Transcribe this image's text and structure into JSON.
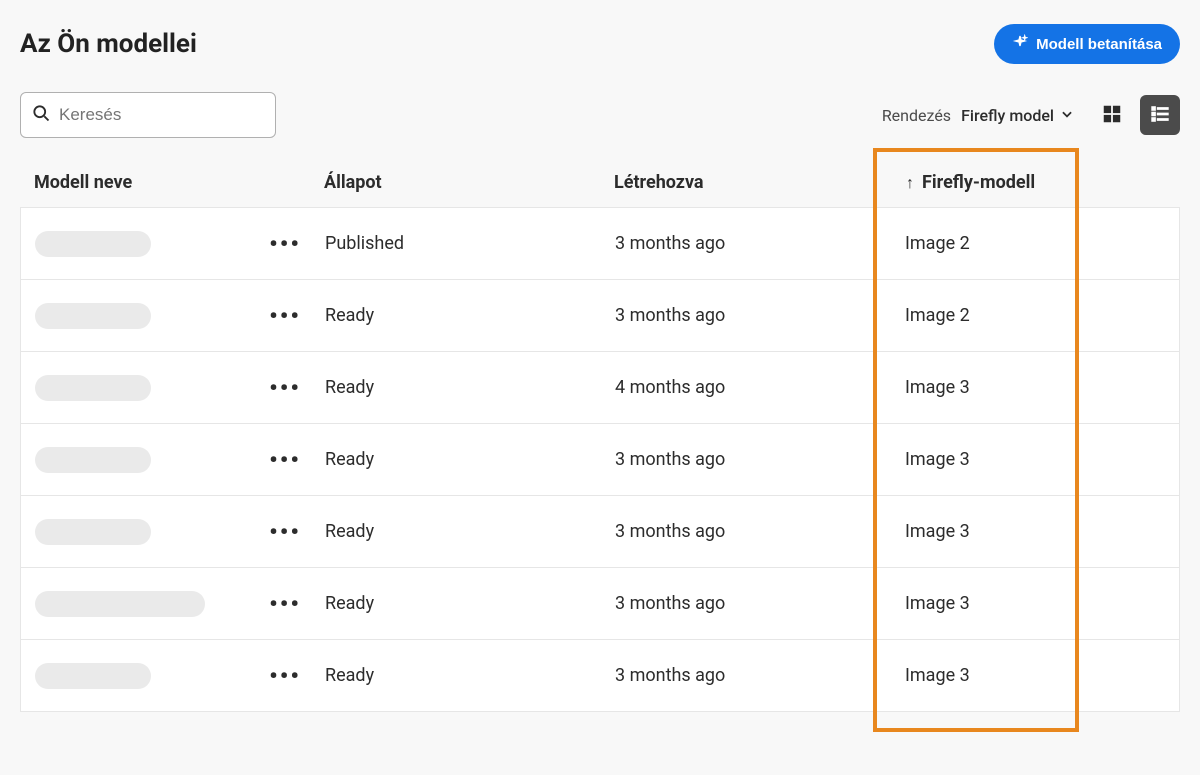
{
  "header": {
    "title": "Az Ön modellei",
    "train_button_label": "Modell betanítása"
  },
  "search": {
    "placeholder": "Keresés"
  },
  "sort": {
    "label": "Rendezés",
    "selected": "Firefly model"
  },
  "table": {
    "columns": {
      "name": "Modell neve",
      "status": "Állapot",
      "created": "Létrehozva",
      "firefly": "Firefly-modell"
    },
    "rows": [
      {
        "status": "Published",
        "created": "3 months ago",
        "firefly": "Image 2"
      },
      {
        "status": "Ready",
        "created": "3 months ago",
        "firefly": "Image 2"
      },
      {
        "status": "Ready",
        "created": "4 months ago",
        "firefly": "Image 3"
      },
      {
        "status": "Ready",
        "created": "3 months ago",
        "firefly": "Image 3"
      },
      {
        "status": "Ready",
        "created": "3 months ago",
        "firefly": "Image 3"
      },
      {
        "status": "Ready",
        "created": "3 months ago",
        "firefly": "Image 3"
      },
      {
        "status": "Ready",
        "created": "3 months ago",
        "firefly": "Image 3"
      }
    ]
  }
}
